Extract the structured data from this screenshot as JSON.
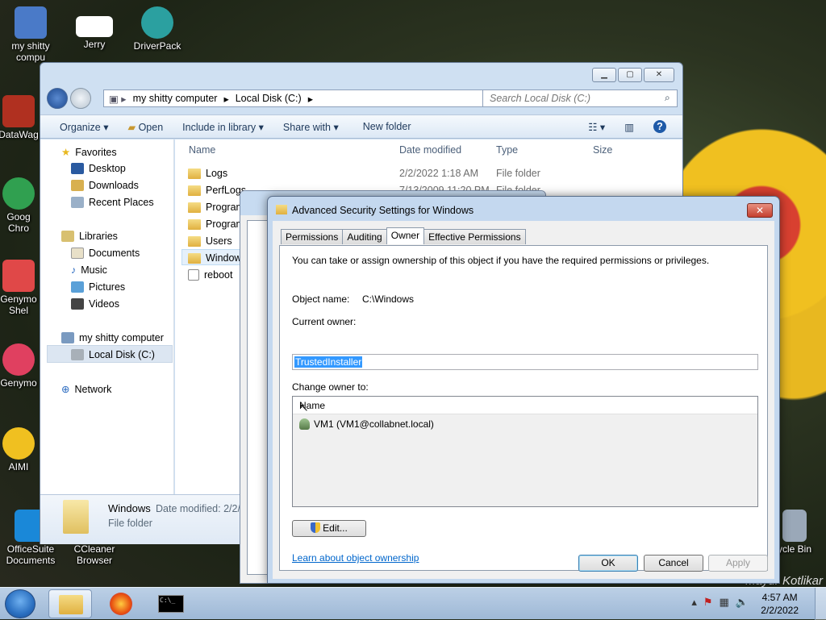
{
  "desktop": {
    "icons": [
      {
        "label": "my shitty compu",
        "color": "#4a7ac8"
      },
      {
        "label": "Jerry",
        "color": "#e8d060"
      },
      {
        "label": "DriverPack",
        "color": "#2ba0a0"
      },
      {
        "label": "DataWag",
        "color": "#b03020"
      },
      {
        "label": "Goog Chro",
        "color": "#30a050"
      },
      {
        "label": "Genymo Shel",
        "color": "#e04848"
      },
      {
        "label": "Genymo",
        "color": "#e04060"
      },
      {
        "label": "AIMI",
        "color": "#f0c020"
      },
      {
        "label": "OfficeSuite Documents",
        "color": "#1a88d8"
      },
      {
        "label": "CCleaner Browser",
        "color": "#2d6ed6"
      },
      {
        "label": "ycle Bin",
        "color": "#9aa8b8"
      }
    ],
    "watermark": "Mayur Kotlikar"
  },
  "explorer": {
    "breadcrumb": [
      "my shitty computer",
      "Local Disk (C:)"
    ],
    "search_placeholder": "Search Local Disk (C:)",
    "toolbar": {
      "organize": "Organize ▾",
      "open": "Open",
      "include": "Include in library ▾",
      "share": "Share with ▾",
      "new_folder": "New folder"
    },
    "nav": {
      "favorites": "Favorites",
      "desktop": "Desktop",
      "downloads": "Downloads",
      "recent": "Recent Places",
      "libraries": "Libraries",
      "documents": "Documents",
      "music": "Music",
      "pictures": "Pictures",
      "videos": "Videos",
      "computer": "my shitty computer",
      "local_disk": "Local Disk (C:)",
      "network": "Network"
    },
    "columns": {
      "name": "Name",
      "date": "Date modified",
      "type": "Type",
      "size": "Size"
    },
    "files": [
      {
        "name": "Logs",
        "date": "2/2/2022 1:18 AM",
        "type": "File folder"
      },
      {
        "name": "PerfLogs",
        "date": "7/13/2009 11:20 PM",
        "type": "File folder"
      },
      {
        "name": "Program",
        "date": "",
        "type": ""
      },
      {
        "name": "Program",
        "date": "",
        "type": ""
      },
      {
        "name": "Users",
        "date": "",
        "type": ""
      },
      {
        "name": "Window",
        "date": "",
        "type": ""
      },
      {
        "name": "reboot",
        "date": "",
        "type": ""
      }
    ],
    "details": {
      "name": "Windows",
      "meta": "Date modified:  2/2/",
      "type": "File folder"
    }
  },
  "dialog": {
    "title": "Advanced Security Settings for Windows",
    "close": "✕",
    "tabs": [
      "Permissions",
      "Auditing",
      "Owner",
      "Effective Permissions"
    ],
    "active_tab": "Owner",
    "intro": "You can take or assign ownership of this object if you have the required permissions or privileges.",
    "object_name_label": "Object name:",
    "object_name_value": "C:\\Windows",
    "current_owner_label": "Current owner:",
    "current_owner_value": "TrustedInstaller",
    "change_owner_label": "Change owner to:",
    "list_header": "Name",
    "list_items": [
      "VM1 (VM1@collabnet.local)"
    ],
    "edit_button": "Edit...",
    "learn_link": "Learn about object ownership",
    "ok": "OK",
    "cancel": "Cancel",
    "apply": "Apply"
  },
  "taskbar": {
    "time": "4:57 AM",
    "date": "2/2/2022"
  }
}
